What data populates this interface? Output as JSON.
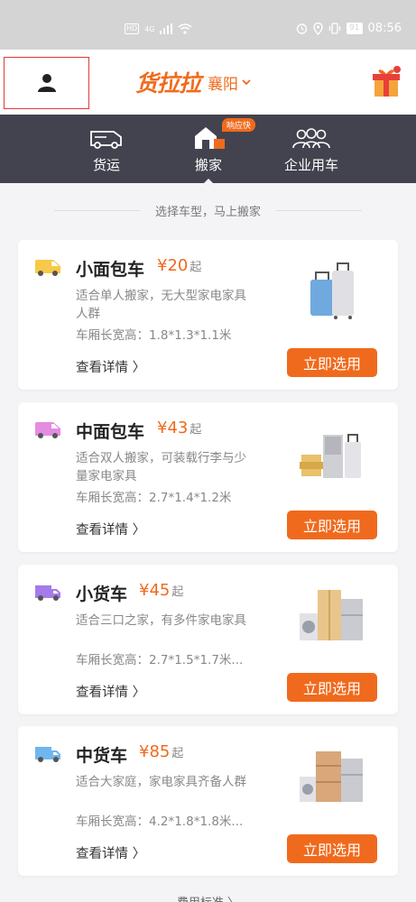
{
  "status_bar": {
    "net": "HD",
    "net2": "4G",
    "battery": "91",
    "time": "08:56"
  },
  "header": {
    "brand": "货拉拉",
    "city": "襄阳"
  },
  "nav": {
    "tabs": [
      {
        "label": "货运"
      },
      {
        "label": "搬家",
        "badge": "响应快"
      },
      {
        "label": "企业用车"
      }
    ]
  },
  "subtitle": "选择车型，马上搬家",
  "vehicles": [
    {
      "name": "小面包车",
      "price": "¥20",
      "unit": "起",
      "desc": "适合单人搬家，无大型家电家具人群",
      "size": "车厢长宽高：1.8*1.3*1.1米",
      "detail": "查看详情 〉",
      "cta": "立即选用",
      "color": "#f7c948"
    },
    {
      "name": "中面包车",
      "price": "¥43",
      "unit": "起",
      "desc": "适合双人搬家，可装载行李与少量家电家具",
      "size": "车厢长宽高：2.7*1.4*1.2米",
      "detail": "查看详情 〉",
      "cta": "立即选用",
      "color": "#e58be0"
    },
    {
      "name": "小货车",
      "price": "¥45",
      "unit": "起",
      "desc": "适合三口之家，有多件家电家具",
      "size": "车厢长宽高：2.7*1.5*1.7米...",
      "detail": "查看详情 〉",
      "cta": "立即选用",
      "color": "#a57be8"
    },
    {
      "name": "中货车",
      "price": "¥85",
      "unit": "起",
      "desc": "适合大家庭，家电家具齐备人群",
      "size": "车厢长宽高：4.2*1.8*1.8米...",
      "detail": "查看详情 〉",
      "cta": "立即选用",
      "color": "#6fb6ee"
    }
  ],
  "footer": {
    "link": "费用标准 〉"
  },
  "accent": "#f06a1d"
}
